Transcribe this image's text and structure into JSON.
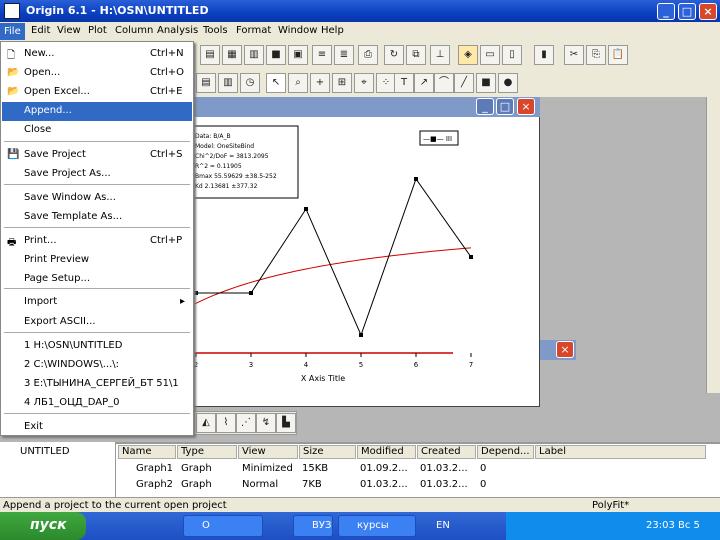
{
  "window": {
    "title": "Origin 6.1 - H:\\OSN\\UNTITLED"
  },
  "menubar": [
    "File",
    "Edit",
    "View",
    "Plot",
    "Column",
    "Analysis",
    "Tools",
    "Format",
    "Window",
    "Help"
  ],
  "file_menu": [
    {
      "label": "New...",
      "shortcut": "Ctrl+N",
      "icon": "new-document-icon"
    },
    {
      "label": "Open...",
      "shortcut": "Ctrl+O",
      "icon": "open-folder-icon"
    },
    {
      "label": "Open Excel...",
      "shortcut": "Ctrl+E",
      "icon": "open-excel-icon"
    },
    {
      "label": "Append...",
      "shortcut": "",
      "icon": ""
    },
    {
      "label": "Close",
      "shortcut": "",
      "icon": ""
    },
    {
      "label": "Save Project",
      "shortcut": "Ctrl+S",
      "icon": "save-icon"
    },
    {
      "label": "Save Project As...",
      "shortcut": "",
      "icon": ""
    },
    {
      "label": "Save Window As...",
      "shortcut": "",
      "icon": ""
    },
    {
      "label": "Save Template As...",
      "shortcut": "",
      "icon": ""
    },
    {
      "label": "Print...",
      "shortcut": "Ctrl+P",
      "icon": "print-icon"
    },
    {
      "label": "Print Preview",
      "shortcut": "",
      "icon": ""
    },
    {
      "label": "Page Setup...",
      "shortcut": "",
      "icon": ""
    },
    {
      "label": "Import",
      "shortcut": "",
      "icon": "submenu-arrow-icon"
    },
    {
      "label": "Export ASCII...",
      "shortcut": "",
      "icon": ""
    },
    {
      "label": "1 H:\\OSN\\UNTITLED",
      "shortcut": "",
      "icon": ""
    },
    {
      "label": "2 C:\\WINDOWS\\...\\:",
      "shortcut": "",
      "icon": ""
    },
    {
      "label": "3 E:\\ТЫНИНА_СЕРГЕЙ_БТ 51\\1",
      "shortcut": "",
      "icon": ""
    },
    {
      "label": "4 ЛБ1_ОЦД_DAP_0",
      "shortcut": "",
      "icon": ""
    },
    {
      "label": "Exit",
      "shortcut": "",
      "icon": ""
    }
  ],
  "graph": {
    "xlabel": "X Axis Title",
    "legend": "—■— III",
    "info_lines": [
      "Data: B/A_B",
      "Model: OneSiteBind",
      "Chi^2/DoF = 3813.2095",
      "R^2 = 0.11905",
      "Bmax 55.59629 ±38.5-252",
      "Kd 2.13681 ±377.32"
    ]
  },
  "chart_data": {
    "type": "line",
    "x": [
      2,
      3,
      4,
      5,
      6,
      7
    ],
    "xticks": [
      "2",
      "3",
      "4",
      "5",
      "6",
      "7"
    ],
    "series": [
      {
        "name": "III",
        "x": [
          1.8,
          2,
          3,
          4,
          5,
          6,
          7
        ],
        "values": [
          50,
          50,
          50,
          120,
          15,
          145,
          80
        ],
        "color": "#000000"
      }
    ],
    "fit": {
      "color": "#cc0000"
    },
    "xlabel": "X Axis Title"
  },
  "explorer": {
    "folder": "UNTITLED",
    "columns": [
      "Name",
      "Type",
      "View",
      "Size",
      "Modified",
      "Created",
      "Depend...",
      "Label"
    ],
    "rows": [
      [
        "Graph1",
        "Graph",
        "Minimized",
        "15KB",
        "01.09.2...",
        "01.03.2...",
        "0",
        ""
      ],
      [
        "Graph2",
        "Graph",
        "Normal",
        "7KB",
        "01.03.2...",
        "01.03.2...",
        "0",
        ""
      ]
    ]
  },
  "status": {
    "message": "Append a project to the current open project",
    "right": "PolyFit*"
  },
  "taskbar": {
    "start": "пуск",
    "items": [
      "O",
      "ВУЗ",
      "курсы"
    ],
    "lang": "EN",
    "clock": "23:03 Вс 5"
  }
}
